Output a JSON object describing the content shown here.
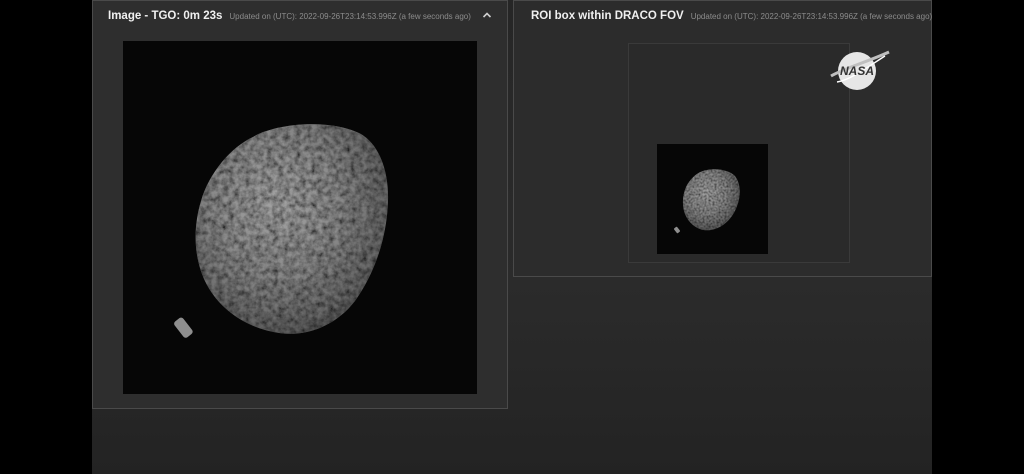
{
  "panels": {
    "image": {
      "title": "Image - TGO: 0m 23s",
      "updated": "Updated on (UTC): 2022-09-26T23:14:53.996Z (a few seconds ago)"
    },
    "roi": {
      "title": "ROI box within DRACO FOV",
      "updated": "Updated on (UTC): 2022-09-26T23:14:53.996Z (a few seconds ago)"
    }
  },
  "logo": {
    "text": "NASA"
  },
  "icons": {
    "collapse": "chevron-up-icon",
    "logo": "nasa-meatball-icon"
  },
  "colors": {
    "background": "#000000",
    "dashboard": "#282828",
    "panel": "#2e2e2e",
    "panel_border": "#4a4a4a",
    "title_text": "#f0f0f0",
    "muted_text": "#8c8c8c",
    "image_background": "#060606",
    "asteroid": "#8a8a8a"
  }
}
